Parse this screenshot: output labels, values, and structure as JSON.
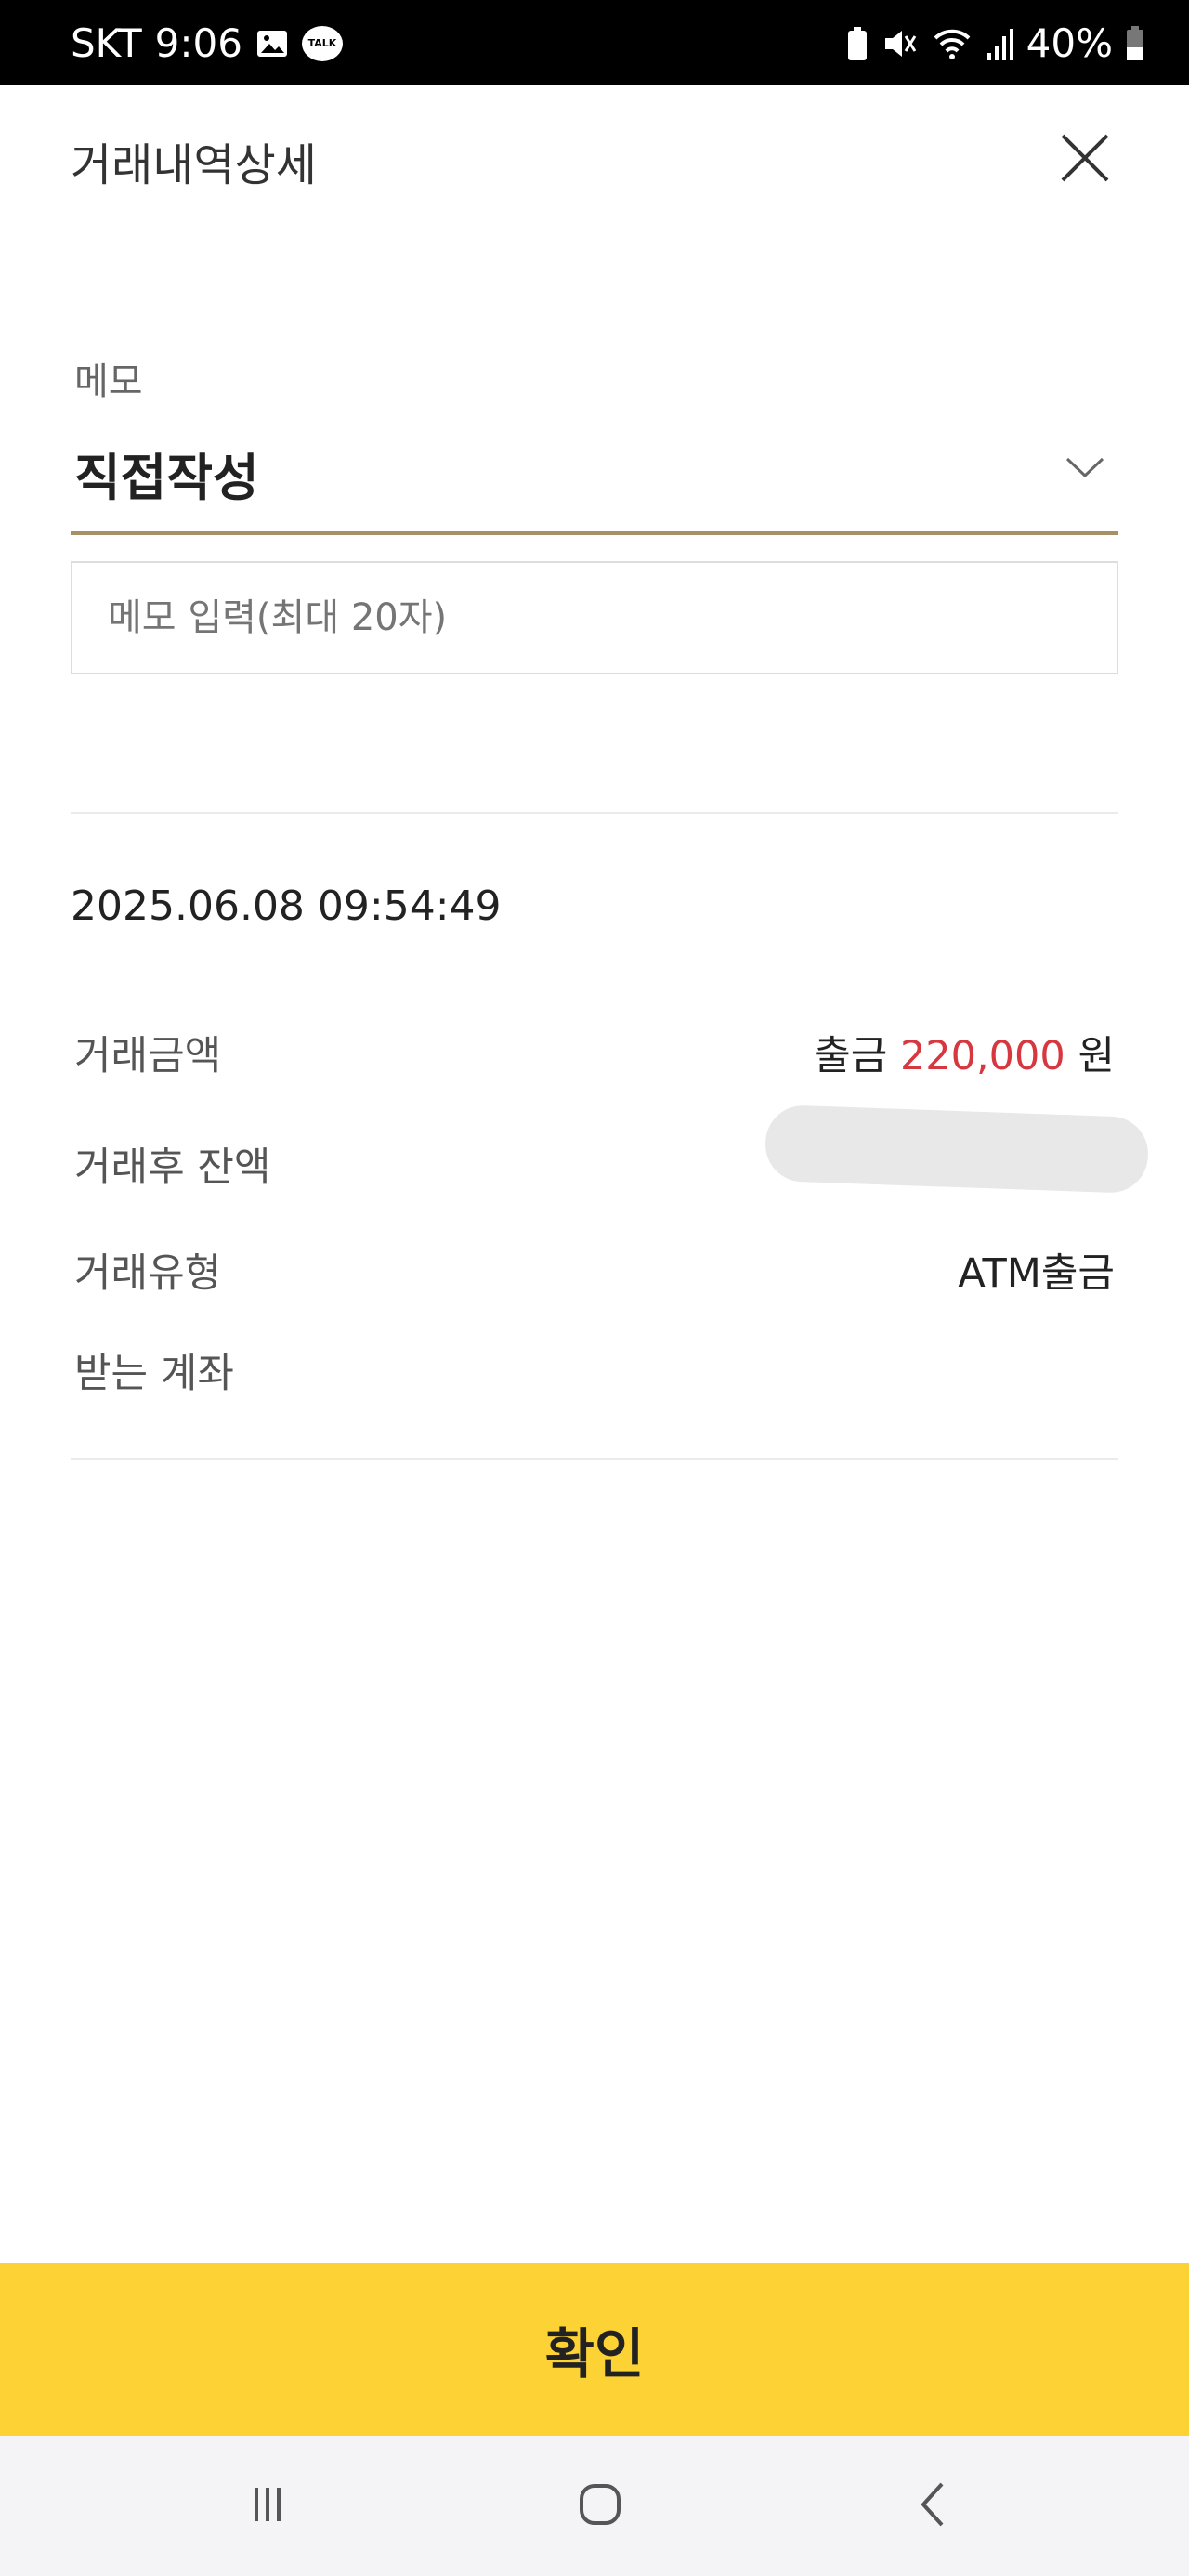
{
  "status_bar": {
    "carrier": "SKT",
    "time": "9:06",
    "battery": "40%",
    "icons": [
      "gallery-icon",
      "kakaotalk-icon",
      "battery-saver-icon",
      "mute-icon",
      "wifi-icon",
      "signal-icon",
      "battery-icon"
    ],
    "kakao_badge": "TALK"
  },
  "header": {
    "title": "거래내역상세"
  },
  "memo": {
    "label": "메모",
    "selected": "직접작성",
    "placeholder": "메모 입력(최대 20자)",
    "value": ""
  },
  "transaction": {
    "datetime": "2025.06.08 09:54:49",
    "amount_label": "거래금액",
    "amount_type": "출금",
    "amount": "220,000",
    "amount_unit": "원",
    "balance_label": "거래후 잔액",
    "type_label": "거래유형",
    "type_value": "ATM출금",
    "account_label": "받는 계좌"
  },
  "footer": {
    "confirm_label": "확인"
  },
  "colors": {
    "accent": "#fdd235",
    "underline": "#a89066",
    "amount": "#d7373f"
  }
}
